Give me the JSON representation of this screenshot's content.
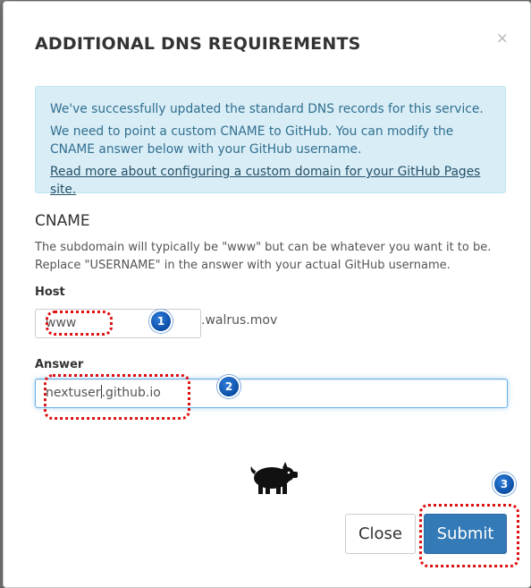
{
  "modal": {
    "title": "ADDITIONAL DNS REQUIREMENTS",
    "close_icon": "×"
  },
  "info": {
    "line1": "We've successfully updated the standard DNS records for this service.",
    "line2": "We need to point a custom CNAME to GitHub. You can modify the CNAME answer below with your GitHub username.",
    "link": "Read more about configuring a custom domain for your GitHub Pages site."
  },
  "cname": {
    "title": "CNAME",
    "description": "The subdomain will typically be \"www\" but can be whatever you want it to be. Replace \"USERNAME\" in the answer with your actual GitHub username."
  },
  "host": {
    "label": "Host",
    "value": "www",
    "suffix": ".walrus.mov"
  },
  "answer": {
    "label": "Answer",
    "value_before_caret": "nextuser",
    "value_after_caret": ".github.io"
  },
  "badges": [
    "1",
    "2",
    "3"
  ],
  "icons": {
    "mascot": "pig-icon"
  },
  "buttons": {
    "close": "Close",
    "submit": "Submit"
  },
  "colors": {
    "info_bg": "#d9edf7",
    "info_text": "#31708f",
    "primary": "#337ab7",
    "callout": "#dd1111"
  }
}
